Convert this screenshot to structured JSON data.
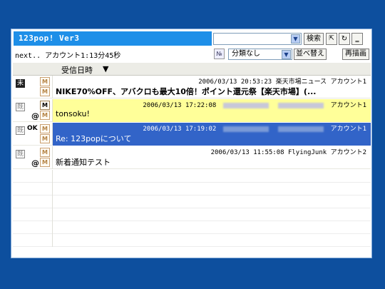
{
  "app": {
    "title": "123pop! Ver3"
  },
  "toolbar": {
    "search_value": "",
    "search_label": "検索",
    "minimize_label": "‗"
  },
  "status": {
    "next_text": "next.. アカウント1:13分45秒"
  },
  "filter": {
    "n_icon": "№",
    "category_value": "分類なし",
    "sort_label": "並べ替え",
    "redraw_label": "再描画"
  },
  "list_header": {
    "received_label": "受信日時",
    "sort_arrow": "▼"
  },
  "messages": [
    {
      "status": "未",
      "ok": "",
      "attachment": "",
      "m1": "M",
      "m2": "M",
      "datetime": "2006/03/13 20:53:23",
      "sender": "楽天市場ニュース",
      "account": "アカウント1",
      "subject": "NIKE70%OFF、アバクロも最大10倍！ポイント還元祭【楽天市場】(...",
      "highlight": "none"
    },
    {
      "status": "既",
      "ok": "",
      "attachment": "@",
      "m1": "M",
      "m2": "M",
      "datetime": "2006/03/13 17:22:08",
      "sender": "",
      "account": "アカウント1",
      "subject": "tonsoku!",
      "highlight": "yellow"
    },
    {
      "status": "既",
      "ok": "OK",
      "attachment": "",
      "m1": "M",
      "m2": "M",
      "datetime": "2006/03/13 17:19:02",
      "sender": "",
      "account": "アカウント1",
      "subject": "Re: 123popについて",
      "highlight": "blue"
    },
    {
      "status": "既",
      "ok": "",
      "attachment": "@",
      "m1": "M",
      "m2": "M",
      "datetime": "2006/03/13 11:55:08",
      "sender": "FlyingJunk",
      "account": "アカウント2",
      "subject": "新着通知テスト",
      "highlight": "none"
    }
  ],
  "colors": {
    "desktop": "#0d4f9e",
    "titlebar": "#1e8fe8",
    "yellow_row": "#ffff99",
    "selected_row": "#3264c8"
  }
}
